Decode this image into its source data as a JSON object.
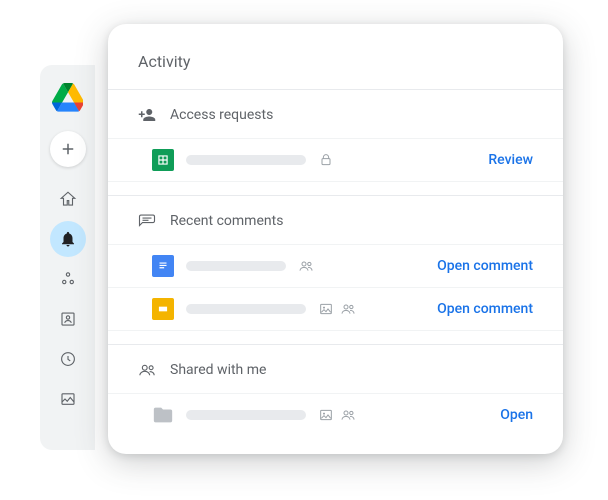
{
  "panel": {
    "title": "Activity",
    "sections": {
      "access": {
        "label": "Access requests",
        "rows": [
          {
            "action": "Review"
          }
        ]
      },
      "comments": {
        "label": "Recent comments",
        "rows": [
          {
            "action": "Open comment"
          },
          {
            "action": "Open comment"
          }
        ]
      },
      "shared": {
        "label": "Shared with me",
        "rows": [
          {
            "action": "Open"
          }
        ]
      }
    }
  },
  "colors": {
    "link": "#1a73e8",
    "muted": "#5f6368",
    "sheets": "#0f9d58",
    "docs": "#4285f4",
    "slides": "#f4b400",
    "folder": "#bdc1c6"
  }
}
